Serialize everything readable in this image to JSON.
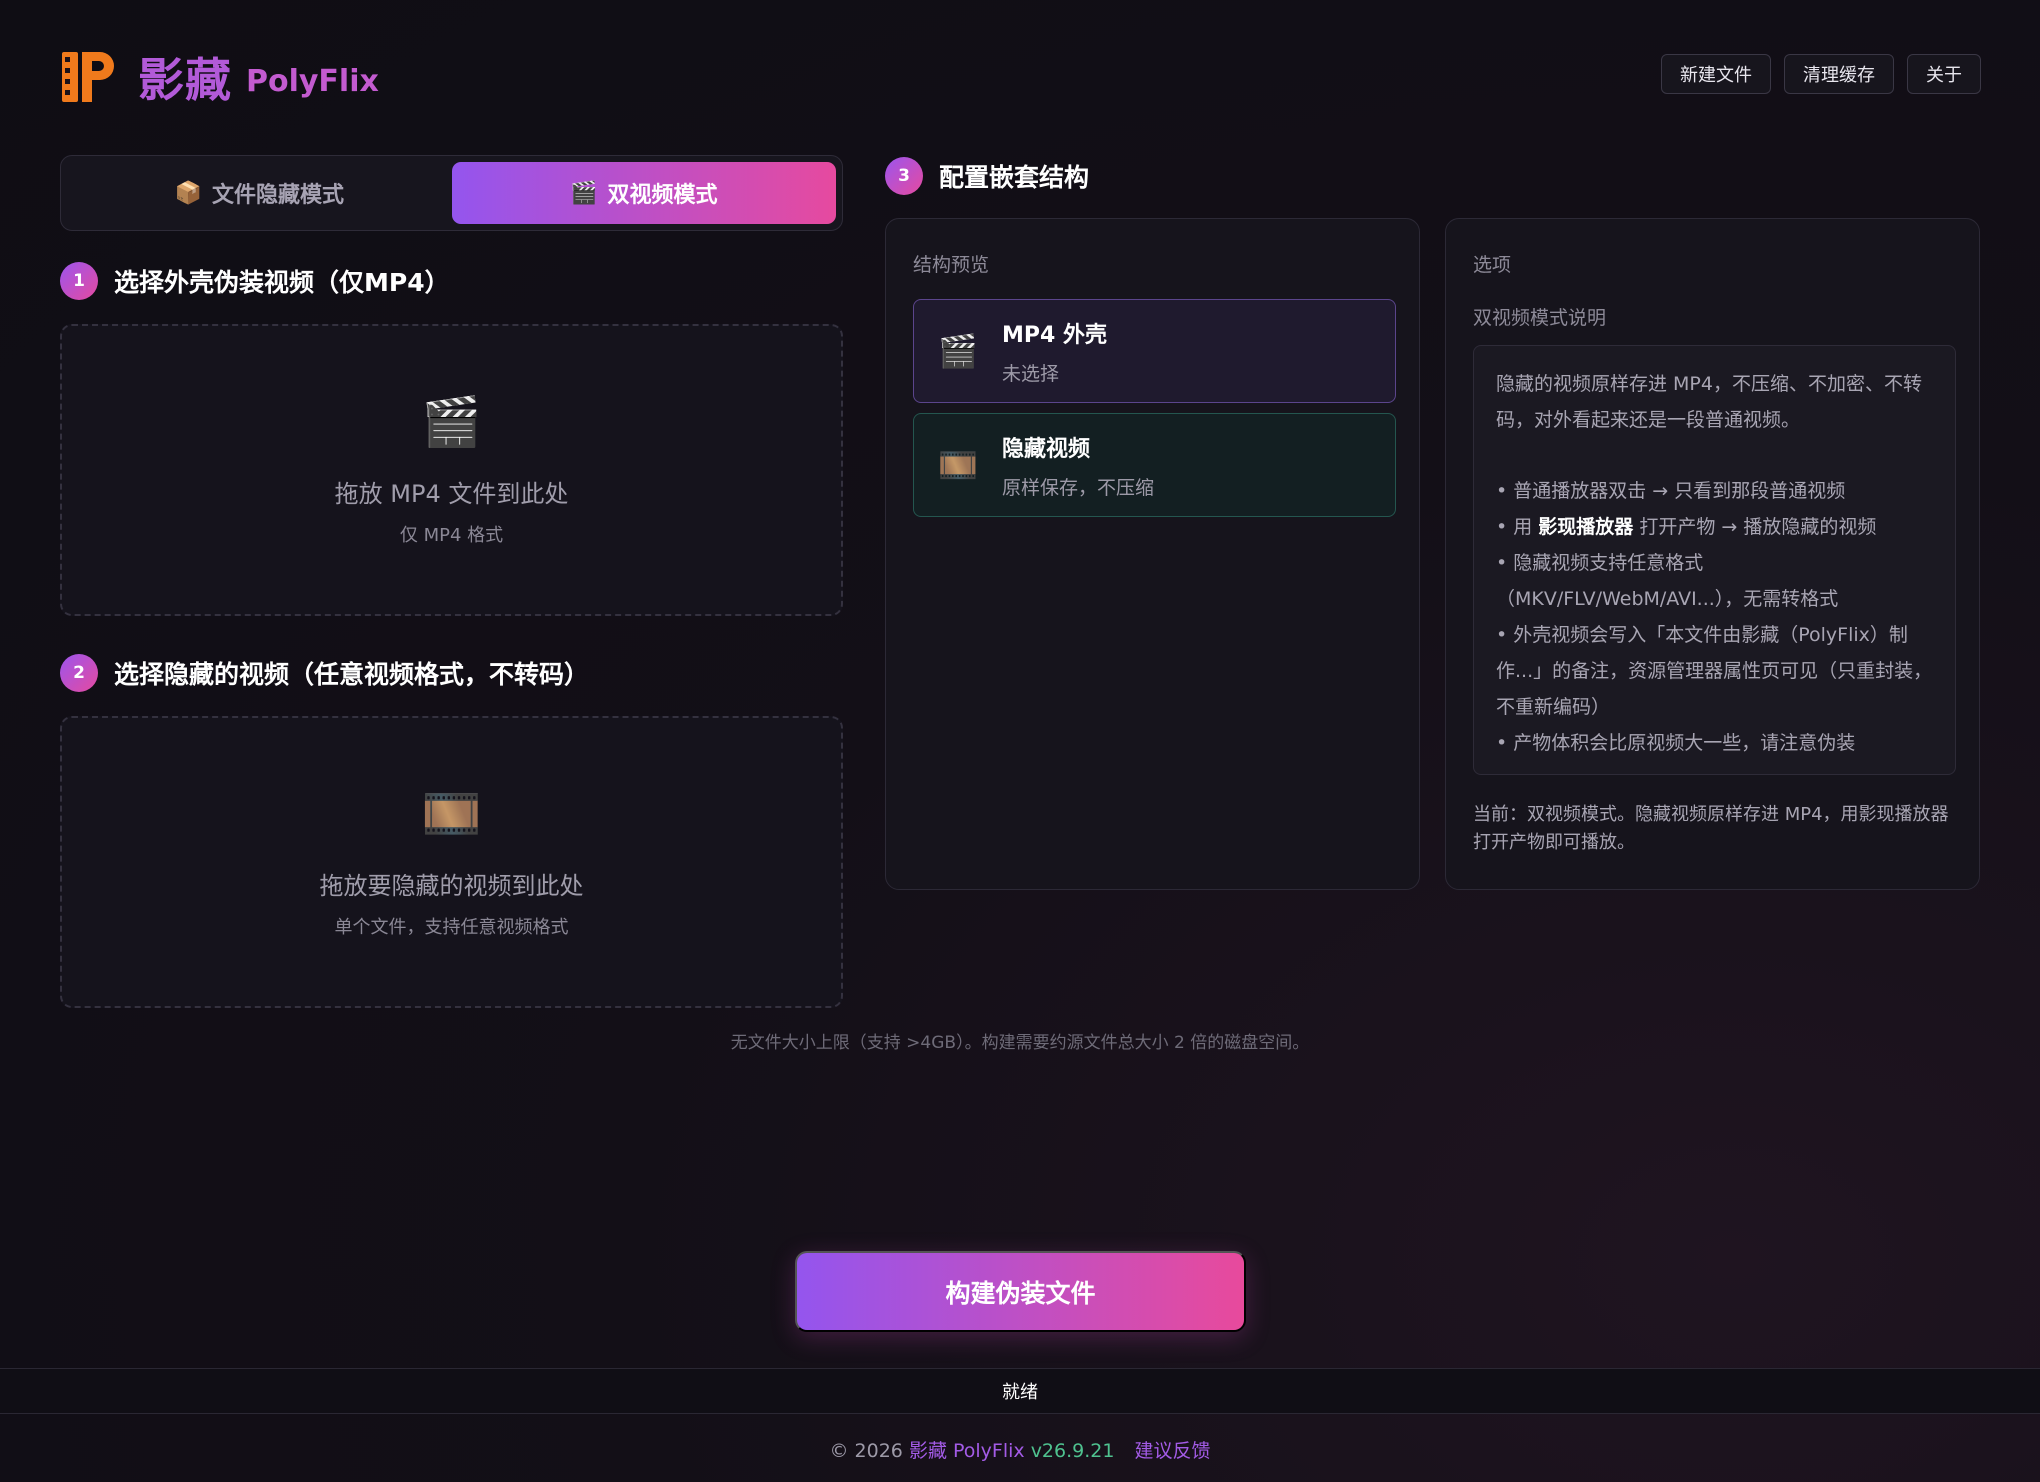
{
  "colors": {
    "accent_start": "#9455ee",
    "accent_end": "#e64a9f",
    "version_green": "#4fc28f"
  },
  "header": {
    "logo_icon": "film-strip-p-logo-icon",
    "app_name_cn": "影藏",
    "app_name_en": "PolyFlix",
    "actions": [
      "新建文件",
      "清理缓存",
      "关于"
    ]
  },
  "mode_switch": {
    "tabs": [
      {
        "icon": "package-icon",
        "glyph": "📦",
        "label": "文件隐藏模式",
        "active": false
      },
      {
        "icon": "clapper-icon",
        "glyph": "🎬",
        "label": "双视频模式",
        "active": true
      }
    ]
  },
  "step1": {
    "number": "1",
    "title": "选择外壳伪装视频（仅MP4）",
    "drop_icon": "🎬",
    "drop_title": "拖放 MP4 文件到此处",
    "drop_sub": "仅 MP4 格式"
  },
  "step2": {
    "number": "2",
    "title": "选择隐藏的视频（任意视频格式，不转码）",
    "drop_icon": "🎞️",
    "drop_title": "拖放要隐藏的视频到此处",
    "drop_sub": "单个文件，支持任意视频格式"
  },
  "note": "无文件大小上限（支持 >4GB）。构建需要约源文件总大小 2 倍的磁盘空间。",
  "step3": {
    "number": "3",
    "title": "配置嵌套结构",
    "structure": {
      "label": "结构预览",
      "mp4": {
        "icon": "🎬",
        "title": "MP4 外壳",
        "sub": "未选择"
      },
      "hidden": {
        "icon": "🎞️",
        "title": "隐藏视频",
        "sub": "原样保存，不压缩"
      }
    },
    "options": {
      "label": "选项",
      "desc_label": "双视频模式说明",
      "intro": "隐藏的视频原样存进 MP4，不压缩、不加密、不转码，对外看起来还是一段普通视频。",
      "bullet1": "• 普通播放器双击 → 只看到那段普通视频",
      "bullet2_pre": "• 用 ",
      "bullet2_strong": "影现播放器",
      "bullet2_post": " 打开产物 → 播放隐藏的视频",
      "bullet3": "• 隐藏视频支持任意格式（MKV/FLV/WebM/AVI...），无需转格式",
      "bullet4": "• 外壳视频会写入「本文件由影藏（PolyFlix）制作...」的备注，资源管理器属性页可见（只重封装，不重新编码）",
      "bullet5": "• 产物体积会比原视频大一些，请注意伪装",
      "current": "当前：双视频模式。隐藏视频原样存进 MP4，用影现播放器打开产物即可播放。"
    }
  },
  "build_button": "构建伪装文件",
  "status": "就绪",
  "footer": {
    "copyright": "© 2026",
    "brand": "影藏 PolyFlix",
    "version": "v26.9.21",
    "feedback": "建议反馈"
  }
}
